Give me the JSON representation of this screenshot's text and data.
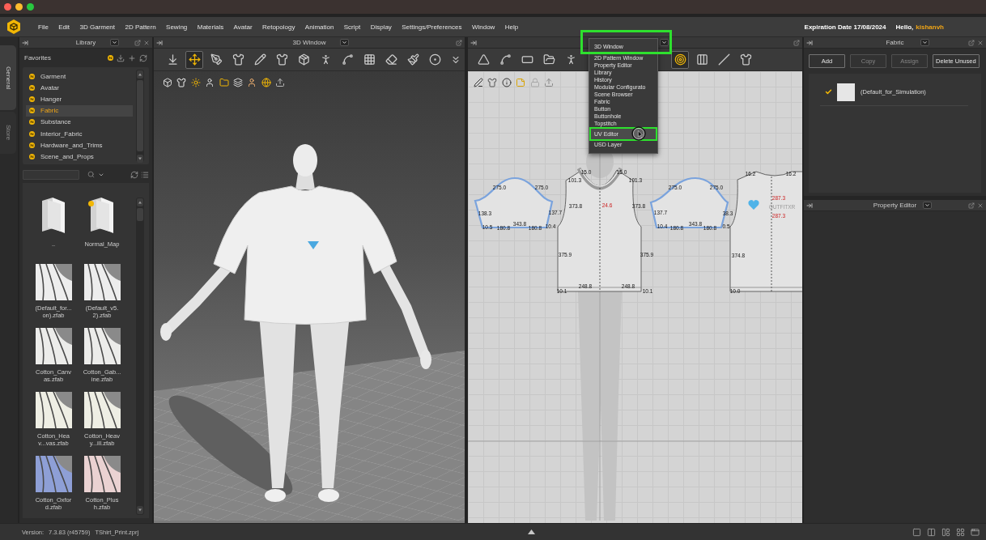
{
  "menu_bar": {
    "items": [
      "File",
      "Edit",
      "3D Garment",
      "2D Pattern",
      "Sewing",
      "Materials",
      "Avatar",
      "Retopology",
      "Animation",
      "Script",
      "Display",
      "Settings/Preferences",
      "Window",
      "Help"
    ],
    "expiration": "Expiration Date 17/08/2024",
    "greeting": "Hello,",
    "user": "kishanvh"
  },
  "side_tabs": [
    {
      "label": "General",
      "selected": true
    },
    {
      "label": "Store",
      "selected": false
    }
  ],
  "library": {
    "title": "Library",
    "section": "Favorites",
    "favorites": [
      {
        "label": "Garment",
        "selected": false
      },
      {
        "label": "Avatar",
        "selected": false
      },
      {
        "label": "Hanger",
        "selected": false
      },
      {
        "label": "Fabric",
        "selected": true
      },
      {
        "label": "Substance",
        "selected": false
      },
      {
        "label": "Interior_Fabric",
        "selected": false
      },
      {
        "label": "Hardware_and_Trims",
        "selected": false
      },
      {
        "label": "Scene_and_Props",
        "selected": false
      }
    ],
    "files": [
      {
        "name": "..",
        "kind": "folder",
        "favorite": false
      },
      {
        "name": "Normal_Map",
        "kind": "folder",
        "favorite": true
      },
      {
        "name": "(Default_for...on).zfab",
        "kind": "fabric",
        "favorite": false,
        "color": "#ededed"
      },
      {
        "name": "(Default_v5.2).zfab",
        "kind": "fabric",
        "favorite": false,
        "color": "#ededed"
      },
      {
        "name": "Cotton_Canvas.zfab",
        "kind": "fabric",
        "favorite": false,
        "color": "#ececea"
      },
      {
        "name": "Cotton_Gab...ine.zfab",
        "kind": "fabric",
        "favorite": false,
        "color": "#ececea"
      },
      {
        "name": "Cotton_Heav...vas.zfab",
        "kind": "fabric",
        "favorite": false,
        "color": "#eeeee4"
      },
      {
        "name": "Cotton_Heavy...ill.zfab",
        "kind": "fabric",
        "favorite": false,
        "color": "#eeeee4"
      },
      {
        "name": "Cotton_Oxford.zfab",
        "kind": "fabric",
        "favorite": false,
        "color": "#8e9fd6"
      },
      {
        "name": "Cotton_Plush.zfab",
        "kind": "fabric",
        "favorite": false,
        "color": "#ead2d2"
      }
    ]
  },
  "viewport_3d": {
    "title": "3D Window",
    "tools": [
      {
        "selected": false
      },
      {
        "selected": true
      },
      {
        "selected": false
      },
      {
        "selected": false
      },
      {
        "selected": false
      },
      {
        "selected": false
      },
      {
        "selected": false
      },
      {
        "selected": false
      },
      {
        "selected": false
      },
      {
        "selected": false
      },
      {
        "selected": false
      },
      {
        "selected": false
      },
      {
        "selected": false
      }
    ]
  },
  "pattern_window": {
    "dropdown_highlighted": true,
    "menu": [
      {
        "label": "3D Window",
        "highlighted": false
      },
      {
        "label": "2D Pattern Window",
        "highlighted": false
      },
      {
        "label": "Property Editor",
        "highlighted": false
      },
      {
        "label": "Library",
        "highlighted": false
      },
      {
        "label": "History",
        "highlighted": false
      },
      {
        "label": "Modular Configurato",
        "highlighted": false
      },
      {
        "label": "Scene Browser",
        "highlighted": false
      },
      {
        "label": "Fabric",
        "highlighted": false
      },
      {
        "label": "Button",
        "highlighted": false
      },
      {
        "label": "Buttonhole",
        "highlighted": false
      },
      {
        "label": "Topstitch",
        "highlighted": false
      },
      {
        "label": "UV Editor",
        "highlighted": true
      },
      {
        "label": "USD Layer",
        "highlighted": false
      }
    ],
    "tools": [
      {
        "selected": false
      },
      {
        "selected": false
      },
      {
        "selected": false
      },
      {
        "selected": false
      },
      {
        "selected": false
      },
      {
        "selected": true
      },
      {
        "selected": false
      },
      {
        "selected": false
      },
      {
        "selected": false
      }
    ],
    "pieces": [
      {
        "labels": [
          {
            "text": "275.0",
            "kind": "measure"
          },
          {
            "text": "275.0",
            "kind": "measure"
          },
          {
            "text": "138.3",
            "kind": "measure"
          },
          {
            "text": "137.7",
            "kind": "measure"
          },
          {
            "text": "343.8",
            "kind": "measure"
          },
          {
            "text": "10.5",
            "kind": "measure"
          },
          {
            "text": "180.8",
            "kind": "measure"
          },
          {
            "text": "180.8",
            "kind": "measure"
          },
          {
            "text": "10.4",
            "kind": "measure"
          }
        ]
      },
      {
        "labels": [
          {
            "text": "15.0",
            "kind": "measure"
          },
          {
            "text": "15.0",
            "kind": "measure"
          },
          {
            "text": "101.3",
            "kind": "measure"
          },
          {
            "text": "101.3",
            "kind": "measure"
          },
          {
            "text": "373.8",
            "kind": "measure"
          },
          {
            "text": "24.6",
            "kind": "accent"
          },
          {
            "text": "373.8",
            "kind": "measure"
          },
          {
            "text": "375.9",
            "kind": "measure"
          },
          {
            "text": "375.9",
            "kind": "measure"
          },
          {
            "text": "248.8",
            "kind": "measure"
          },
          {
            "text": "248.8",
            "kind": "measure"
          },
          {
            "text": "10.1",
            "kind": "measure"
          },
          {
            "text": "10.1",
            "kind": "measure"
          }
        ]
      },
      {
        "labels": [
          {
            "text": "275.0",
            "kind": "measure"
          },
          {
            "text": "275.0",
            "kind": "measure"
          },
          {
            "text": "137.7",
            "kind": "measure"
          },
          {
            "text": "38.3",
            "kind": "measure"
          },
          {
            "text": "343.8",
            "kind": "measure"
          },
          {
            "text": "10.4",
            "kind": "measure"
          },
          {
            "text": "180.8",
            "kind": "measure"
          },
          {
            "text": "180.8",
            "kind": "measure"
          },
          {
            "text": "0.5",
            "kind": "measure"
          }
        ]
      },
      {
        "labels": [
          {
            "text": "16.2",
            "kind": "measure"
          },
          {
            "text": "16.2",
            "kind": "measure"
          },
          {
            "text": "287.3",
            "kind": "accent"
          },
          {
            "text": "OUTFITXR",
            "kind": "logo"
          },
          {
            "text": "287.3",
            "kind": "accent"
          },
          {
            "text": "374.8",
            "kind": "measure"
          },
          {
            "text": "10.0",
            "kind": "measure"
          }
        ]
      }
    ]
  },
  "fabric_panel": {
    "title": "Fabric",
    "buttons": [
      {
        "label": "Add",
        "disabled": false
      },
      {
        "label": "Copy",
        "disabled": true
      },
      {
        "label": "Assign",
        "disabled": true
      },
      {
        "label": "Delete Unused",
        "disabled": false
      }
    ],
    "fabrics": [
      {
        "name": "(Default_for_Simulation)",
        "checked": true,
        "color": "#e6e6e6"
      }
    ]
  },
  "property_editor": {
    "title": "Property Editor"
  },
  "status_bar": {
    "version_label": "Version:",
    "version": "7.3.83 (r45759)",
    "file": "TShirt_Print.zprj"
  }
}
